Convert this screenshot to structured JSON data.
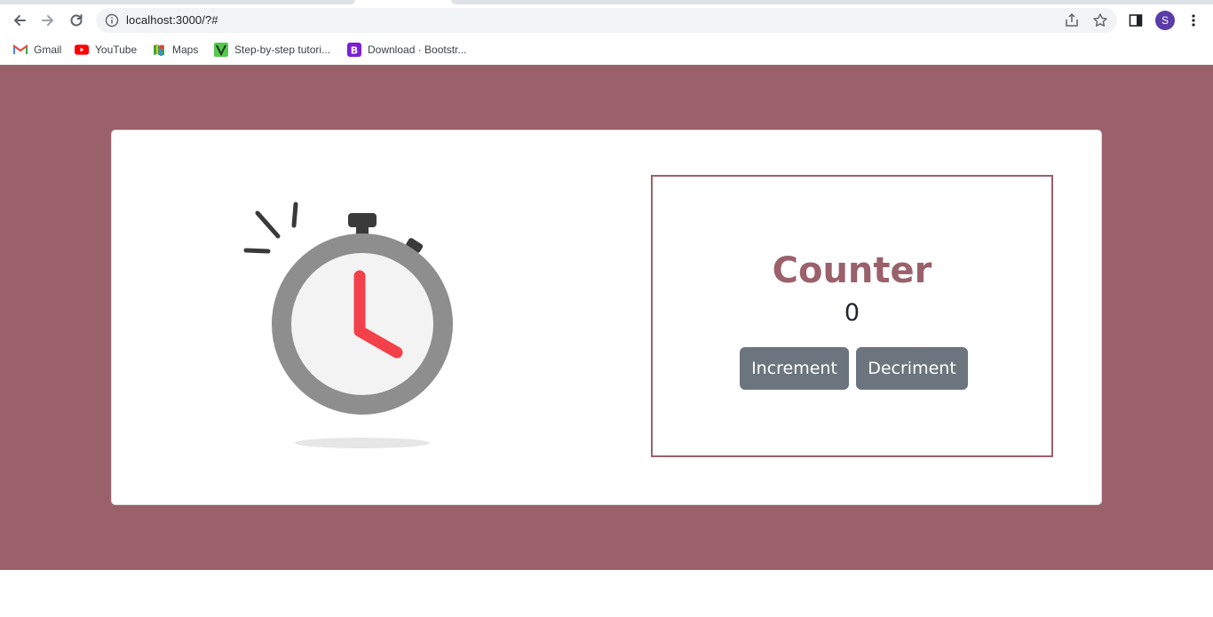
{
  "browser": {
    "url": "localhost:3000/?#",
    "profile_initial": "S",
    "bookmarks": [
      {
        "label": "Gmail",
        "icon": "gmail-icon"
      },
      {
        "label": "YouTube",
        "icon": "youtube-icon"
      },
      {
        "label": "Maps",
        "icon": "maps-icon"
      },
      {
        "label": "Step-by-step tutori...",
        "icon": "vue-icon"
      },
      {
        "label": "Download · Bootstr...",
        "icon": "bootstrap-icon"
      }
    ]
  },
  "colors": {
    "background": "#9a616b",
    "accent": "#9a616b",
    "button": "#6c757d",
    "clock_hand": "#f2414a"
  },
  "counter": {
    "title": "Counter",
    "value": "0",
    "increment_label": "Increment",
    "decrement_label": "Decriment"
  }
}
